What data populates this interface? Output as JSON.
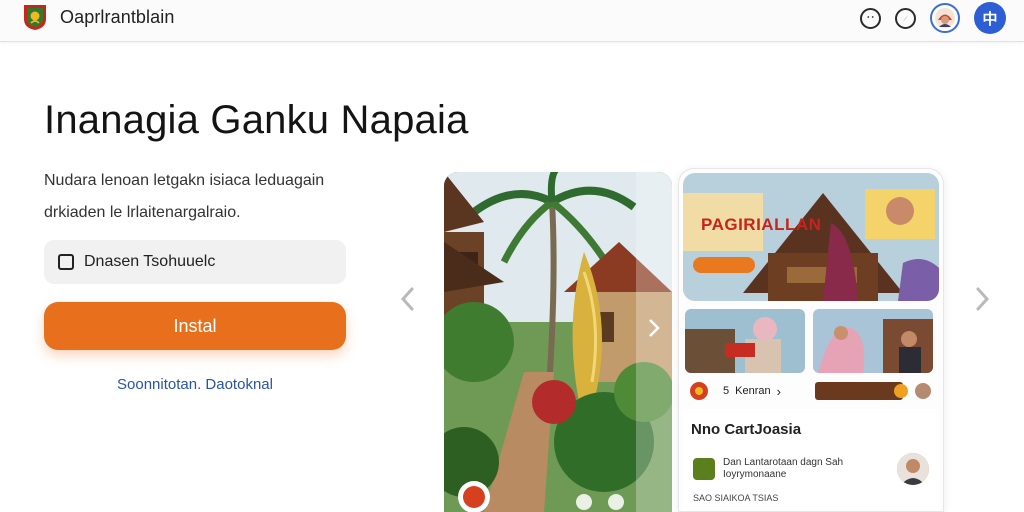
{
  "header": {
    "app_title": "Oaprlrantblain",
    "icons": [
      "smile-icon",
      "compass-icon",
      "profile-icon",
      "menu-icon"
    ],
    "menu_glyph": "中"
  },
  "hero": {
    "headline": "Inanagia Ganku Napaia",
    "description_line1": "Nudara lenoan letgakn isiaca leduagain",
    "description_line2": "drkiaden le lrlaitenargalraio."
  },
  "form": {
    "checkbox_label": "Dnasen Tsohuuelc",
    "checkbox_checked": false,
    "install_label": "Instal",
    "secondary_link": "Soonnitotan. Daotoknal"
  },
  "preview": {
    "hero_card_title": "PAGIRIALLAN",
    "hero_card_pill": "",
    "meta_a_count": "5",
    "meta_a_label": "Kenran",
    "featured_title": "Nno CartJoasia",
    "featured_line1": "Dan Lantarotaan dagn Sah",
    "featured_line2": "Ioyrymonaane",
    "featured_sub": "SAO SIAIKOA TSIAS"
  },
  "colors": {
    "accent": "#e8701c",
    "link": "#2a54a3",
    "menu_bg": "#2c5fd4"
  }
}
